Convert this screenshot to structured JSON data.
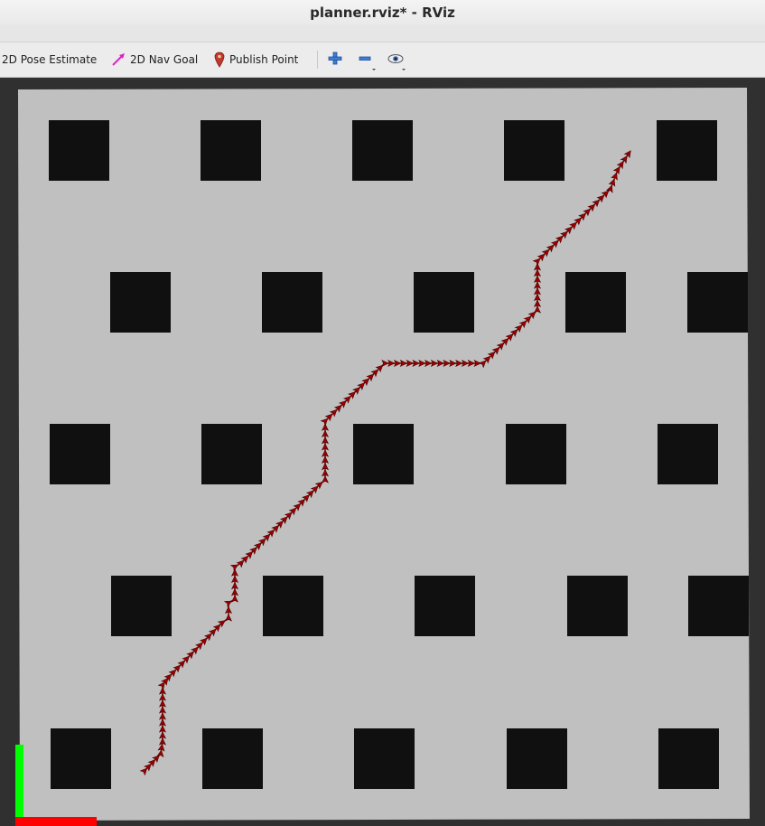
{
  "window": {
    "title": "planner.rviz* - RViz"
  },
  "toolbar": {
    "pose_estimate_label": "2D Pose Estimate",
    "nav_goal_label": "2D Nav Goal",
    "publish_point_label": "Publish Point",
    "icons": [
      "zoom-in-icon",
      "zoom-out-icon",
      "eye-icon"
    ]
  },
  "colors": {
    "map_free": "#c0c0c0",
    "obstacle": "#101010",
    "path": "#a00000",
    "axis_x": "#ff0000",
    "axis_y": "#00ff00",
    "background": "#303030"
  }
}
